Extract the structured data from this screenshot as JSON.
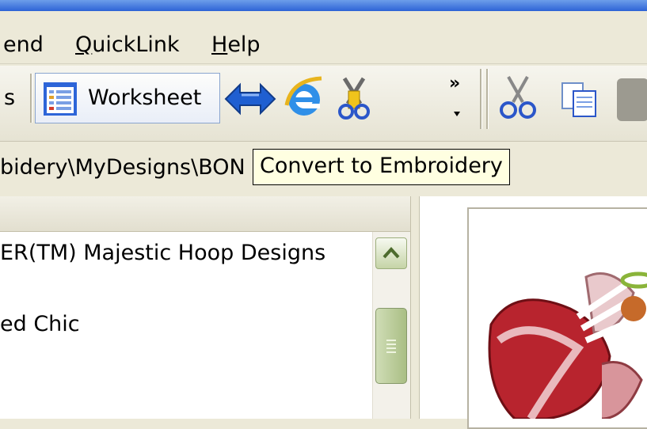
{
  "menubar": {
    "items": [
      {
        "label": "end",
        "key": ""
      },
      {
        "label": "QuickLink",
        "key": "Q"
      },
      {
        "label": "Help",
        "key": "H"
      }
    ]
  },
  "toolbar": {
    "partial_label": "s",
    "worksheet_label": "Worksheet",
    "overflow_glyph": "»",
    "icons": [
      "worksheet-icon",
      "convert-arrows-icon",
      "internet-explorer-icon",
      "scissors-hoop-icon",
      "cut-icon",
      "copy-icon"
    ]
  },
  "address": {
    "path": "bidery\\MyDesigns\\BON"
  },
  "tooltip": {
    "text": "Convert to Embroidery"
  },
  "tree": {
    "items": [
      {
        "label": "ER(TM) Majestic Hoop Designs"
      },
      {
        "label": "ed Chic"
      }
    ]
  },
  "colors": {
    "tooltip_bg": "#ffffe1",
    "chrome": "#ece9d8",
    "scroll_thumb": "#a9be84",
    "arrow_blue": "#1f5fd1",
    "embroidery_red": "#b8242e"
  }
}
